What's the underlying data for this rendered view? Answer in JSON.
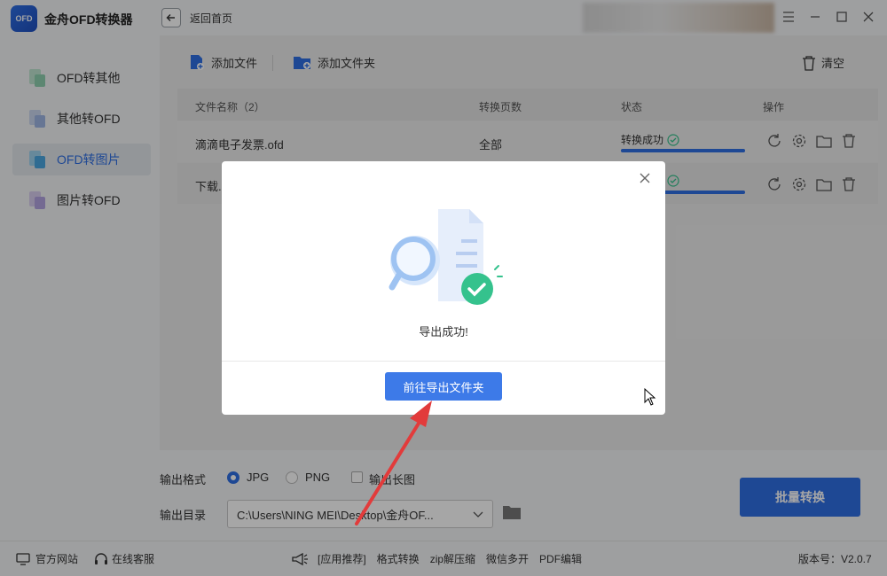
{
  "app": {
    "logo_text": "OFD",
    "title": "金舟OFD转换器",
    "back_label": "返回首页"
  },
  "sidebar": {
    "items": [
      {
        "label": "OFD转其他",
        "active": false
      },
      {
        "label": "其他转OFD",
        "active": false
      },
      {
        "label": "OFD转图片",
        "active": true
      },
      {
        "label": "图片转OFD",
        "active": false
      }
    ]
  },
  "toolbar": {
    "add_file": "添加文件",
    "add_folder": "添加文件夹",
    "clear": "清空"
  },
  "table": {
    "headers": [
      "文件名称（2）",
      "转换页数",
      "状态",
      "操作"
    ],
    "rows": [
      {
        "name": "滴滴电子发票.ofd",
        "pages": "全部",
        "status": "转换成功",
        "progress": 1.0
      },
      {
        "name": "下载...",
        "pages": "",
        "status": "",
        "progress": 1.0
      }
    ]
  },
  "dialog": {
    "message": "导出成功!",
    "button": "前往导出文件夹"
  },
  "options": {
    "format_label": "输出格式",
    "formats": [
      "JPG",
      "PNG"
    ],
    "selected_format": "JPG",
    "long_image_label": "输出长图",
    "dir_label": "输出目录",
    "dir_value": "C:\\Users\\NING MEI\\Desktop\\金舟OF..."
  },
  "batch_button": "批量转换",
  "footer": {
    "official_site": "官方网站",
    "online_service": "在线客服",
    "recommend": "[应用推荐]",
    "links": [
      "格式转换",
      "zip解压缩",
      "微信多开",
      "PDF编辑"
    ],
    "version": "版本号：V2.0.7"
  },
  "colors": {
    "accent": "#2f6fe4",
    "success": "#35c28d",
    "annotation_arrow": "#e23b3b"
  }
}
